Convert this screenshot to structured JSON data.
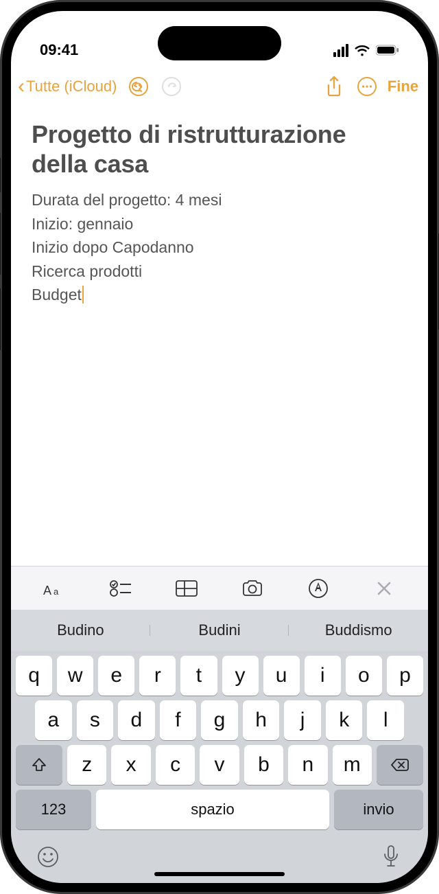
{
  "status": {
    "time": "09:41"
  },
  "nav": {
    "back_label": "Tutte (iCloud)",
    "done_label": "Fine"
  },
  "note": {
    "title": "Progetto di ristrutturazione della casa",
    "lines": [
      "Durata del progetto: 4 mesi",
      "Inizio: gennaio",
      "Inizio dopo Capodanno",
      "Ricerca prodotti",
      "Budget"
    ]
  },
  "suggestions": [
    "Budino",
    "Budini",
    "Buddismo"
  ],
  "keyboard": {
    "row1": [
      "q",
      "w",
      "e",
      "r",
      "t",
      "y",
      "u",
      "i",
      "o",
      "p"
    ],
    "row2": [
      "a",
      "s",
      "d",
      "f",
      "g",
      "h",
      "j",
      "k",
      "l"
    ],
    "row3": [
      "z",
      "x",
      "c",
      "v",
      "b",
      "n",
      "m"
    ],
    "numeric_label": "123",
    "space_label": "spazio",
    "return_label": "invio"
  },
  "colors": {
    "accent": "#e8a33d"
  }
}
